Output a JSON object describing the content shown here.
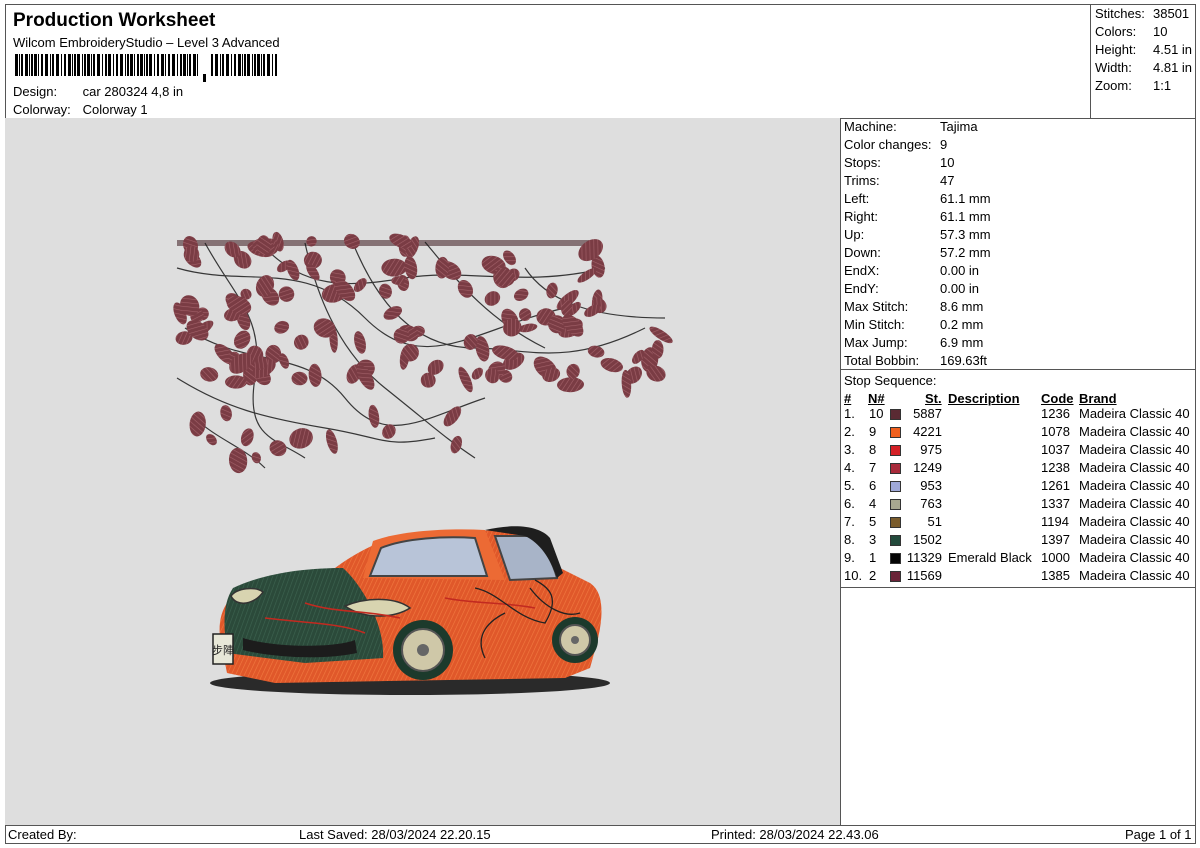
{
  "header": {
    "title": "Production Worksheet",
    "software": "Wilcom EmbroideryStudio – Level 3 Advanced",
    "design_label": "Design:",
    "design_value": "car 280324 4,8 in",
    "colorway_label": "Colorway:",
    "colorway_value": "Colorway 1"
  },
  "summary": [
    {
      "label": "Stitches:",
      "value": "38501"
    },
    {
      "label": "Colors:",
      "value": "10"
    },
    {
      "label": "Height:",
      "value": "4.51 in"
    },
    {
      "label": "Width:",
      "value": "4.81 in"
    },
    {
      "label": "Zoom:",
      "value": "1:1"
    }
  ],
  "machine_info": [
    {
      "label": "Machine:",
      "value": "Tajima"
    },
    {
      "label": "Color changes:",
      "value": "9"
    },
    {
      "label": "Stops:",
      "value": "10"
    },
    {
      "label": "Trims:",
      "value": "47"
    },
    {
      "label": "Left:",
      "value": "61.1 mm"
    },
    {
      "label": "Right:",
      "value": "61.1 mm"
    },
    {
      "label": "Up:",
      "value": "57.3 mm"
    },
    {
      "label": "Down:",
      "value": "57.2 mm"
    },
    {
      "label": "EndX:",
      "value": "0.00 in"
    },
    {
      "label": "EndY:",
      "value": "0.00 in"
    },
    {
      "label": "Max Stitch:",
      "value": "8.6 mm"
    },
    {
      "label": "Min Stitch:",
      "value": "0.2 mm"
    },
    {
      "label": "Max Jump:",
      "value": "6.9 mm"
    },
    {
      "label": "Total Bobbin:",
      "value": "169.63ft"
    }
  ],
  "stop_sequence": {
    "title": "Stop Sequence:",
    "columns": {
      "index": "#",
      "needle": "N#",
      "stitches": "St.",
      "description": "Description",
      "code": "Code",
      "brand": "Brand"
    },
    "rows": [
      {
        "index": "1.",
        "needle": "10",
        "color": "#5a2a33",
        "stitches": "5887",
        "description": "",
        "code": "1236",
        "brand": "Madeira Classic 40"
      },
      {
        "index": "2.",
        "needle": "9",
        "color": "#f0601e",
        "stitches": "4221",
        "description": "",
        "code": "1078",
        "brand": "Madeira Classic 40"
      },
      {
        "index": "3.",
        "needle": "8",
        "color": "#d42026",
        "stitches": "975",
        "description": "",
        "code": "1037",
        "brand": "Madeira Classic 40"
      },
      {
        "index": "4.",
        "needle": "7",
        "color": "#a82a3a",
        "stitches": "1249",
        "description": "",
        "code": "1238",
        "brand": "Madeira Classic 40"
      },
      {
        "index": "5.",
        "needle": "6",
        "color": "#9fa8d8",
        "stitches": "953",
        "description": "",
        "code": "1261",
        "brand": "Madeira Classic 40"
      },
      {
        "index": "6.",
        "needle": "4",
        "color": "#a8a890",
        "stitches": "763",
        "description": "",
        "code": "1337",
        "brand": "Madeira Classic 40"
      },
      {
        "index": "7.",
        "needle": "5",
        "color": "#7a5c2c",
        "stitches": "51",
        "description": "",
        "code": "1194",
        "brand": "Madeira Classic 40"
      },
      {
        "index": "8.",
        "needle": "3",
        "color": "#234a3c",
        "stitches": "1502",
        "description": "",
        "code": "1397",
        "brand": "Madeira Classic 40"
      },
      {
        "index": "9.",
        "needle": "1",
        "color": "#050505",
        "stitches": "11329",
        "description": "Emerald Black",
        "code": "1000",
        "brand": "Madeira Classic 40"
      },
      {
        "index": "10.",
        "needle": "2",
        "color": "#6a2438",
        "stitches": "11569",
        "description": "",
        "code": "1385",
        "brand": "Madeira Classic 40"
      }
    ]
  },
  "footer": {
    "created_by": "Created By:",
    "last_saved": "Last Saved: 28/03/2024 22.20.15",
    "printed": "Printed: 28/03/2024 22.43.06",
    "page": "Page 1 of 1"
  },
  "preview": {
    "plate_text": "步陣",
    "colors": {
      "canvas": "#dedede",
      "blossom": "#7a3c44",
      "branch": "#1a1a1a",
      "body": "#e0582a",
      "hood": "#2b4a3a",
      "roof": "#1e1e1e"
    }
  }
}
